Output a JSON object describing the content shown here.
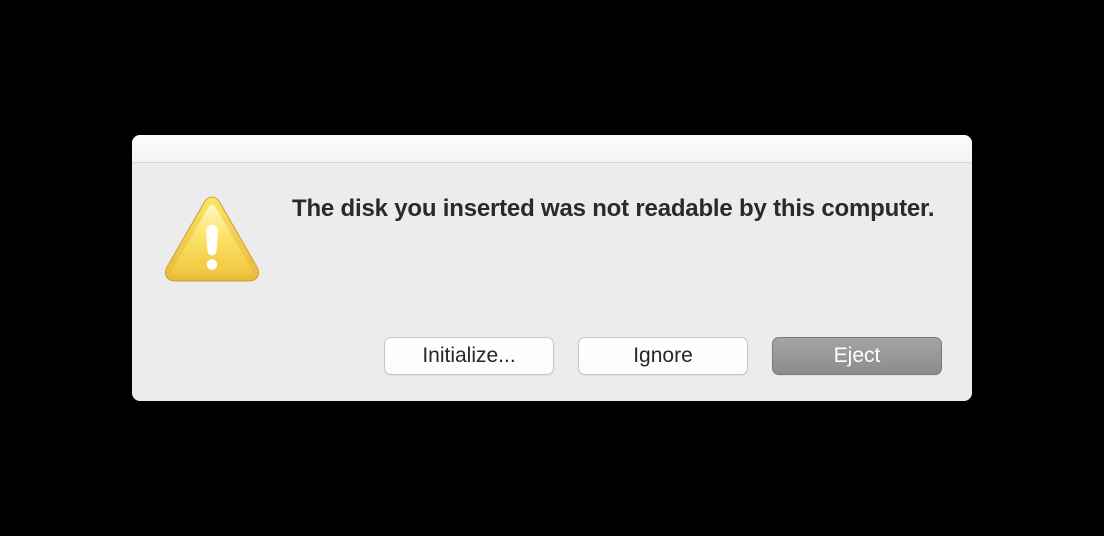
{
  "dialog": {
    "message": "The disk you inserted was not readable by this computer.",
    "buttons": {
      "initialize": "Initialize...",
      "ignore": "Ignore",
      "eject": "Eject"
    }
  }
}
